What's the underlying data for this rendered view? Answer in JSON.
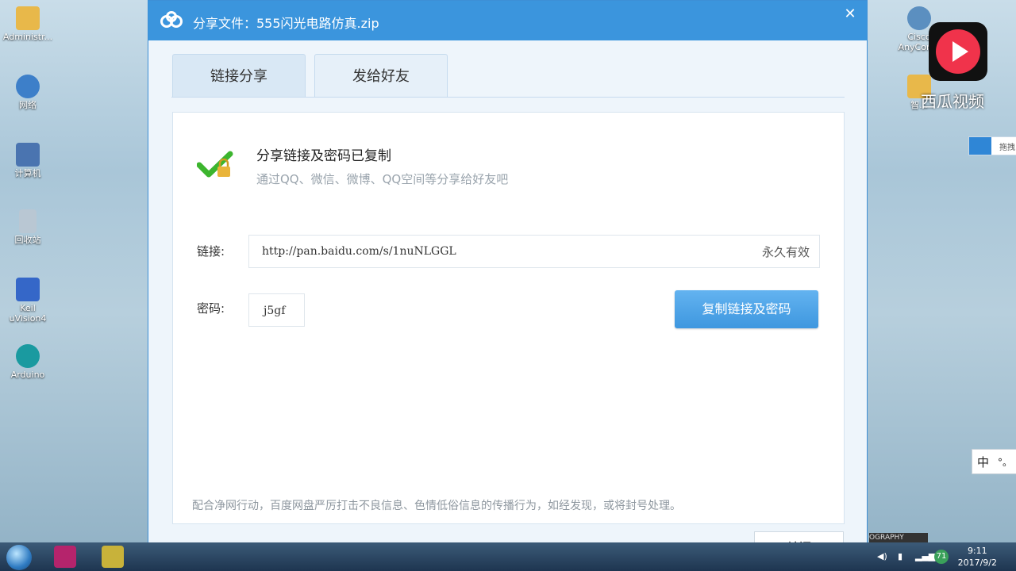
{
  "desktop": {
    "left_icons": [
      {
        "label": "Administr...",
        "color": "#e8b84a"
      },
      {
        "label": "网络",
        "color": "#3d7fc9"
      },
      {
        "label": "计算机",
        "color": "#4a74b0"
      },
      {
        "label": "回收站",
        "color": "#b9c7d3"
      },
      {
        "label": "Keil\nuVision4",
        "color": "#3567c8"
      },
      {
        "label": "Arduino",
        "color": "#1a9aa0"
      }
    ],
    "right_icons": [
      {
        "label": "Cisco\nAnyCon...",
        "color": "#5b8fc0"
      },
      {
        "label": "智...",
        "color": "#e8b84a"
      }
    ]
  },
  "watermark": {
    "text": "西瓜视频",
    "accent": "#f0334b"
  },
  "dialog": {
    "title": "分享文件：555闪光电路仿真.zip",
    "close_glyph": "✕",
    "tabs": [
      {
        "label": "链接分享",
        "active": true
      },
      {
        "label": "发给好友",
        "active": false
      }
    ],
    "success_title": "分享链接及密码已复制",
    "success_sub": "通过QQ、微信、微博、QQ空间等分享给好友吧",
    "link_label": "链接:",
    "link_url": "http://pan.baidu.com/s/1nuNLGGL",
    "link_validity": "永久有效",
    "password_label": "密码:",
    "password_value": "j5gf",
    "copy_button": "复制链接及密码",
    "notice": "配合净网行动，百度网盘严厉打击不良信息、色情低俗信息的传播行为，如经发现，或将封号处理。",
    "close_button": "关闭",
    "accent": "#3b95dd"
  },
  "floating": {
    "baidu_tab_text": "拖拽",
    "ime_left": "中",
    "ime_right": "°。"
  },
  "taskbar": {
    "clock_time": "9:11",
    "clock_date": "2017/9/2",
    "tray_badge": "71",
    "partial_text": "OGRAPHY"
  }
}
